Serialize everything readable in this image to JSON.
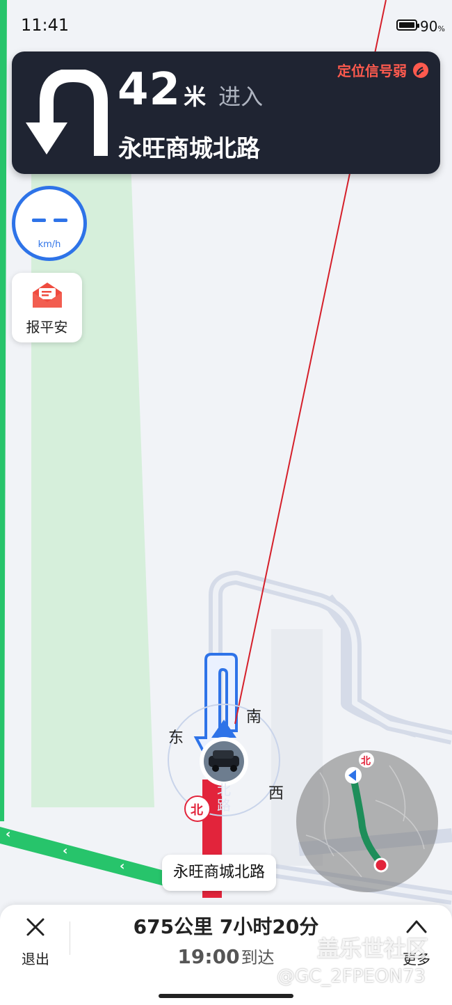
{
  "status_bar": {
    "time": "11:41",
    "battery_level": "90",
    "battery_unit": "%"
  },
  "guidance": {
    "distance_value": "42",
    "distance_unit": "米",
    "action": "进入",
    "road_name": "永旺商城北路",
    "turn_icon": "u-turn-icon",
    "signal_warning": "定位信号弱",
    "signal_icon": "weak-gps-signal-icon"
  },
  "speed": {
    "value": "– –",
    "unit": "km/h"
  },
  "safety_report": {
    "label": "报平安",
    "icon": "envelope-icon"
  },
  "map": {
    "current_road_label": "永旺商城北路",
    "compass": {
      "east": "东",
      "south": "南",
      "west": "西",
      "north": "北"
    },
    "road_vertical_text": "北路",
    "route_color": "#e2243b",
    "highway_color": "#27c46b",
    "accent_color": "#2e73e8"
  },
  "overview": {
    "north_label": "北",
    "route_color": "#1e8e5a"
  },
  "trip": {
    "summary": "675公里 7小时20分",
    "arrival_time": "19:00",
    "arrival_label": "到达"
  },
  "actions": {
    "exit_label": "退出",
    "more_label": "更多"
  },
  "watermark": {
    "site": "盖乐世社区",
    "handle": "@GC_2FPEON73"
  }
}
